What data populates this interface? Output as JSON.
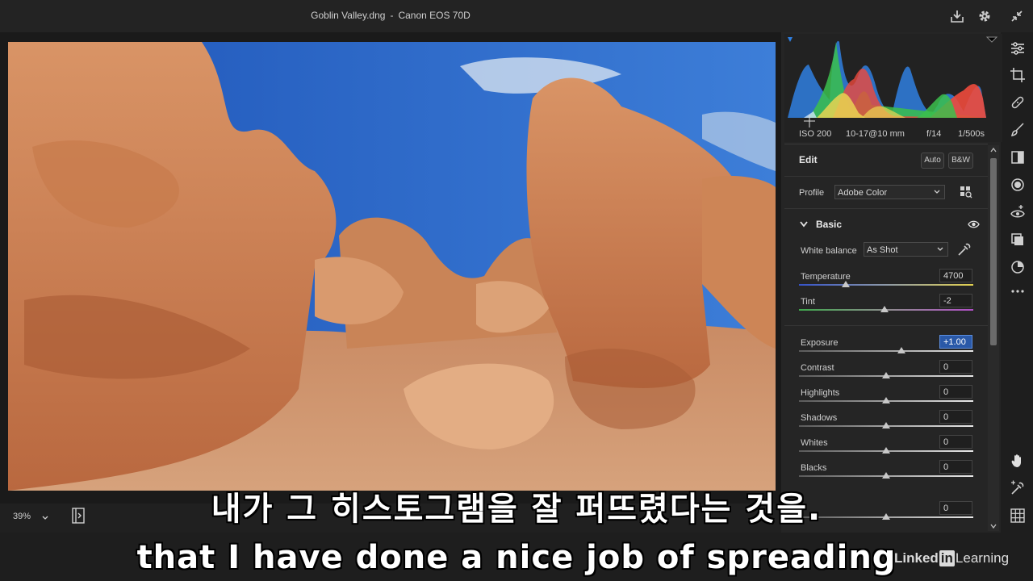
{
  "window": {
    "filename": "Goblin Valley.dng",
    "separator": "-",
    "camera": "Canon EOS 70D",
    "icons": [
      "download-icon",
      "gear-icon",
      "collapse-icon"
    ]
  },
  "canvas": {
    "zoom_value": "39%"
  },
  "histogram": {
    "exif": {
      "iso": "ISO 200",
      "lens": "10-17@10 mm",
      "aperture": "f/14",
      "shutter": "1/500s"
    },
    "colors": {
      "red": "#ee4a3c",
      "green": "#3bbf4c",
      "blue": "#2f7fe0",
      "yellow": "#e9d452"
    }
  },
  "edit": {
    "title": "Edit",
    "auto_label": "Auto",
    "bw_label": "B&W",
    "profile_label": "Profile",
    "profile_value": "Adobe Color",
    "basic_title": "Basic",
    "white_balance_label": "White balance",
    "white_balance_value": "As Shot",
    "sliders": [
      {
        "label": "Temperature",
        "value": "4700",
        "position": 0.27
      },
      {
        "label": "Tint",
        "value": "-2",
        "position": 0.49
      },
      {
        "label": "Exposure",
        "value": "+1.00",
        "position": 0.59,
        "active": true
      },
      {
        "label": "Contrast",
        "value": "0",
        "position": 0.5
      },
      {
        "label": "Highlights",
        "value": "0",
        "position": 0.5
      },
      {
        "label": "Shadows",
        "value": "0",
        "position": 0.5
      },
      {
        "label": "Whites",
        "value": "0",
        "position": 0.5
      },
      {
        "label": "Blacks",
        "value": "0",
        "position": 0.5
      },
      {
        "label": "",
        "value": "0",
        "position": 0.5
      }
    ]
  },
  "tools": [
    "sliders-icon",
    "crop-icon",
    "healing-icon",
    "brush-icon",
    "gradient-icon",
    "radial-icon",
    "red-eye-icon",
    "presets-icon",
    "snapshots-icon",
    "more-icon",
    "hand-icon",
    "sampler-icon",
    "grid-icon"
  ],
  "subtitles": {
    "korean": "내가 그 히스토그램을 잘 퍼뜨렸다는 것을.",
    "english": "that I have done a nice job of spreading"
  },
  "brand": {
    "part1": "Linked",
    "part2": "in",
    "part3": "Learning"
  }
}
